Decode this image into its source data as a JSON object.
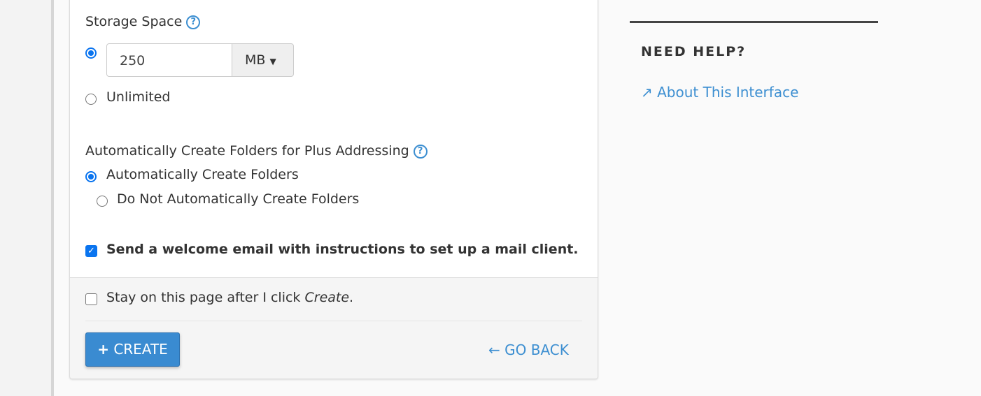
{
  "storage": {
    "label": "Storage Space",
    "value": "250",
    "unit": "MB",
    "unlimited_label": "Unlimited",
    "selected": "value"
  },
  "plus": {
    "label": "Automatically Create Folders for Plus Addressing",
    "options": [
      "Automatically Create Folders",
      "Do Not Automatically Create Folders"
    ],
    "selected": 0
  },
  "welcome": {
    "label": "Send a welcome email with instructions to set up a mail client.",
    "checked": true
  },
  "stay": {
    "prefix": "Stay on this page after I click ",
    "em": "Create",
    "suffix": ".",
    "checked": false
  },
  "actions": {
    "create": "CREATE",
    "go_back": "GO BACK"
  },
  "help": {
    "title": "NEED HELP?",
    "link": "About This Interface"
  },
  "colors": {
    "accent": "#3a8bd1",
    "link": "#3d8fd1"
  }
}
